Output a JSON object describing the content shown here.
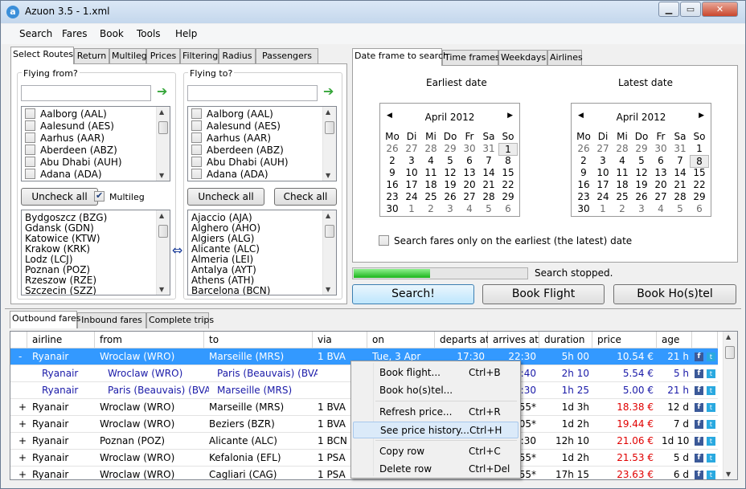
{
  "window": {
    "title": "Azuon 3.5 - 1.xml",
    "app_icon": "a",
    "min": "▁",
    "max": "▭",
    "close": "✕"
  },
  "menu": [
    "Search",
    "Fares",
    "Book",
    "Tools",
    "Help"
  ],
  "left_tabs": [
    "Select Routes",
    "Return",
    "Multileg",
    "Prices",
    "Filtering",
    "Radius",
    "Passengers"
  ],
  "right_tabs": [
    "Date frame to search",
    "Time frames",
    "Weekdays",
    "Airlines"
  ],
  "from": {
    "label": "Flying from?",
    "value": "",
    "airports": [
      "Aalborg (AAL)",
      "Aalesund (AES)",
      "Aarhus (AAR)",
      "Aberdeen (ABZ)",
      "Abu Dhabi (AUH)",
      "Adana (ADA)"
    ],
    "uncheck_label": "Uncheck all",
    "multileg_label": "Multileg",
    "selected": [
      "Bydgoszcz (BZG)",
      "Gdansk (GDN)",
      "Katowice (KTW)",
      "Krakow (KRK)",
      "Lodz (LCJ)",
      "Poznan (POZ)",
      "Rzeszow (RZE)",
      "Szczecin (SZZ)"
    ]
  },
  "swap_icon": "⇔",
  "to": {
    "label": "Flying to?",
    "value": "",
    "airports": [
      "Aalborg (AAL)",
      "Aalesund (AES)",
      "Aarhus (AAR)",
      "Aberdeen (ABZ)",
      "Abu Dhabi (AUH)",
      "Adana (ADA)"
    ],
    "uncheck_label": "Uncheck all",
    "check_label": "Check all",
    "selected": [
      "Ajaccio (AJA)",
      "Alghero (AHO)",
      "Algiers (ALG)",
      "Alicante (ALC)",
      "Almeria (LEI)",
      "Antalya (AYT)",
      "Athens (ATH)",
      "Barcelona (BCN)"
    ]
  },
  "dates": {
    "earliest_label": "Earliest date",
    "latest_label": "Latest date",
    "month": "April 2012",
    "prev": "◀",
    "next": "▶",
    "dow": [
      "Mo",
      "Tu",
      "We",
      "Th",
      "Fr",
      "Sa",
      "Su"
    ],
    "dow_display": [
      "Mo",
      "Di",
      "Mi",
      "Do",
      "Fr",
      "Sa",
      "So"
    ],
    "weeks": [
      [
        "26",
        "27",
        "28",
        "29",
        "30",
        "31",
        "1"
      ],
      [
        "2",
        "3",
        "4",
        "5",
        "6",
        "7",
        "8"
      ],
      [
        "9",
        "10",
        "11",
        "12",
        "13",
        "14",
        "15"
      ],
      [
        "16",
        "17",
        "18",
        "19",
        "20",
        "21",
        "22"
      ],
      [
        "23",
        "24",
        "25",
        "26",
        "27",
        "28",
        "29"
      ],
      [
        "30",
        "1",
        "2",
        "3",
        "4",
        "5",
        "6"
      ]
    ],
    "earliest_selected": "1",
    "latest_selected": "8",
    "only_earliest_label": "Search fares only on the earliest (the latest) date"
  },
  "status": {
    "progress": 0.44,
    "text": "Search stopped."
  },
  "actions": {
    "search": "Search!",
    "book_flight": "Book Flight",
    "book_hostel": "Book Ho(s)tel"
  },
  "result_tabs": [
    "Outbound fares",
    "Inbound fares",
    "Complete trips"
  ],
  "columns": [
    "airline",
    "from",
    "to",
    "via",
    "on",
    "departs at",
    "arrives at",
    "duration",
    "price",
    "age"
  ],
  "rows": [
    {
      "exp": "-",
      "airline": "Ryanair",
      "from": "Wroclaw (WRO)",
      "to": "Marseille (MRS)",
      "via": "1 BVA",
      "on": "Tue, 3 Apr",
      "dep": "17:30",
      "arr": "22:30",
      "dur": "5h 00",
      "price": "10.54 €",
      "age": "21 h",
      "selected": true
    },
    {
      "exp": "",
      "airline": "Ryanair",
      "from": "Wroclaw (WRO)",
      "to": "Paris (Beauvais) (BVA)",
      "via": "",
      "on": "",
      "dep": "",
      "arr": "19:40",
      "dur": "2h 10",
      "price": "5.54 €",
      "age": "5 h",
      "sub": true
    },
    {
      "exp": "",
      "airline": "Ryanair",
      "from": "Paris (Beauvais) (BVA)",
      "to": "Marseille (MRS)",
      "via": "",
      "on": "",
      "dep": "",
      "arr": "22:30",
      "dur": "1h 25",
      "price": "5.00 €",
      "age": "21 h",
      "sub": true
    },
    {
      "exp": "+",
      "airline": "Ryanair",
      "from": "Wroclaw (WRO)",
      "to": "Marseille (MRS)",
      "via": "1 BVA",
      "on": "",
      "dep": "",
      "arr": "20:55*",
      "dur": "1d 3h",
      "price": "18.38 €",
      "age": "12 d"
    },
    {
      "exp": "+",
      "airline": "Ryanair",
      "from": "Wroclaw (WRO)",
      "to": "Beziers (BZR)",
      "via": "1 BVA",
      "on": "",
      "dep": "",
      "arr": "22:05*",
      "dur": "1d 2h",
      "price": "19.44 €",
      "age": "7 d"
    },
    {
      "exp": "+",
      "airline": "Ryanair",
      "from": "Poznan (POZ)",
      "to": "Alicante (ALC)",
      "via": "1 BCN",
      "on": "",
      "dep": "",
      "arr": "18:30",
      "dur": "12h 10",
      "price": "21.06 €",
      "age": "1d 10h"
    },
    {
      "exp": "+",
      "airline": "Ryanair",
      "from": "Wroclaw (WRO)",
      "to": "Kefalonia (EFL)",
      "via": "1 PSA",
      "on": "",
      "dep": "",
      "arr": "19:55*",
      "dur": "1d 2h",
      "price": "21.53 €",
      "age": "5 d"
    },
    {
      "exp": "+",
      "airline": "Ryanair",
      "from": "Wroclaw (WRO)",
      "to": "Cagliari (CAG)",
      "via": "1 PSA",
      "on": "",
      "dep": "",
      "arr": "10:55*",
      "dur": "17h 15",
      "price": "23.63 €",
      "age": "6 d"
    }
  ],
  "context_menu": [
    {
      "label": "Book flight...",
      "key": "Ctrl+B"
    },
    {
      "label": "Book ho(s)tel...",
      "key": ""
    },
    {
      "label": "Refresh price...",
      "key": "Ctrl+R"
    },
    {
      "label": "See price history...",
      "key": "Ctrl+H",
      "highlight": true
    },
    {
      "label": "Copy row",
      "key": "Ctrl+C"
    },
    {
      "label": "Delete row",
      "key": "Ctrl+Del"
    }
  ],
  "colors": {
    "accent": "#3399ff",
    "price_red": "#e00000",
    "link_blue": "#1a1aa8",
    "progress_green": "#1bb51b"
  }
}
